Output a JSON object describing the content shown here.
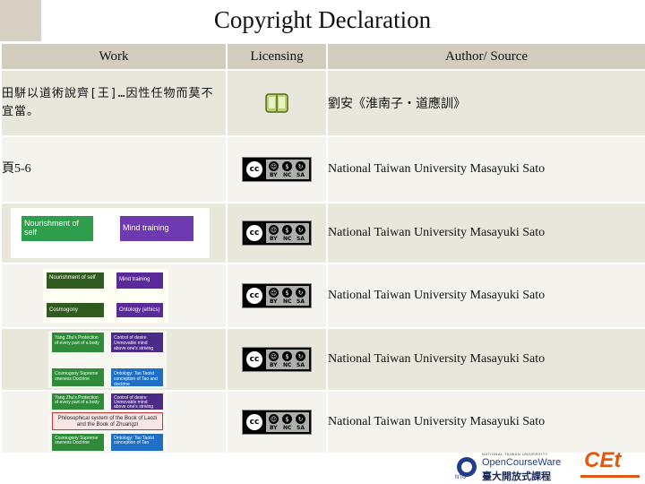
{
  "title": "Copyright Declaration",
  "headers": {
    "work": "Work",
    "licensing": "Licensing",
    "source": "Author/ Source"
  },
  "rows": [
    {
      "work": "田駢以道術說齊[王]…因性任物而莫不宜當。",
      "source": "劉安《淮南子‧道應訓》"
    },
    {
      "work": "頁5-6",
      "source": "National Taiwan University Masayuki Sato"
    },
    {
      "source": "National Taiwan University Masayuki Sato"
    },
    {
      "source": "National Taiwan University Masayuki Sato"
    },
    {
      "source": "National Taiwan University Masayuki Sato"
    },
    {
      "source": "National Taiwan University Masayuki Sato"
    }
  ],
  "badge": {
    "cc": "cc",
    "by": "BY",
    "nc": "NC",
    "sa": "SA"
  },
  "thumbs": {
    "t1": {
      "left": "Nourishment of self",
      "right": "Mind training",
      "left_color": "#2e9d4c",
      "right_color": "#6d3ab0"
    },
    "t2": {
      "tl": "Nourishment of self",
      "tr": "Mind training",
      "bl": "Cosmogony",
      "br": "Ontology (ethics)"
    },
    "t3": {
      "tl": "Yang Zhu's Protection of every part of a body",
      "tr": "Control of desire Unmovable mind above one's striving",
      "bl": "Cosmogony Supreme oneness Doctrine",
      "br": "Ontology: Tao Taoist conception of Tao and doctrine"
    },
    "t4": {
      "tl": "Yang Zhu's Protection of every part of a body",
      "tr": "Control of desire Unmovable mind above one's striving",
      "mid": "Philosophical system of the Book of Laozi and the Book of Zhuangzi",
      "bl": "Cosmogony Supreme oneness Doctrine",
      "br": "Ontology: Tao Taoist conception of Tao"
    }
  },
  "footer": {
    "ocw_line1": "NATIONAL TAIWAN UNIVERSITY",
    "ocw_line2": "OpenCourseWare",
    "ocw_line3": "臺大開放式課程",
    "ntu": "NTU",
    "cet": "CEt"
  },
  "colors": {
    "header_bg": "#d3cdbd",
    "row_odd": "#e9e6dc",
    "row_even": "#f5f3ee"
  }
}
